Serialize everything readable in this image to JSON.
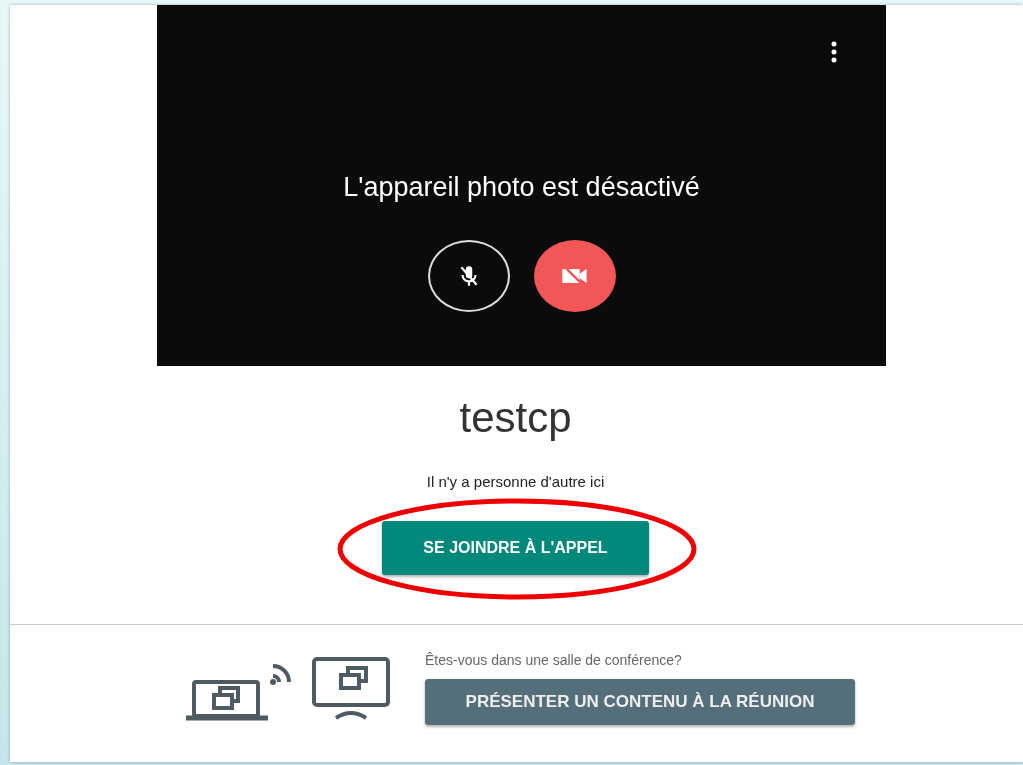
{
  "preview": {
    "message": "L'appareil photo est désactivé",
    "mic_muted": true,
    "camera_off": true
  },
  "meeting": {
    "name": "testcp",
    "participants_note": "Il n'y a personne d'autre ici",
    "join_button": "SE JOINDRE À L'APPEL",
    "join_highlighted": true
  },
  "present": {
    "question": "Êtes-vous dans une salle de conférence?",
    "button": "PRÉSENTER UN CONTENU À LA RÉUNION"
  }
}
